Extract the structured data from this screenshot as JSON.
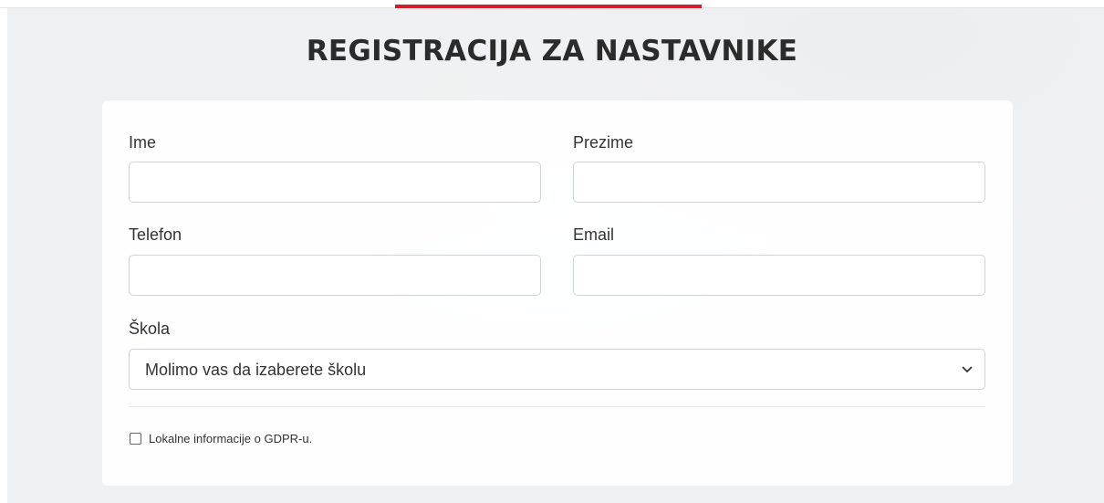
{
  "header": {
    "title": "REGISTRACIJA ZA NASTAVNIKE",
    "accent_color": "#d0202e"
  },
  "form": {
    "first_name": {
      "label": "Ime",
      "value": ""
    },
    "last_name": {
      "label": "Prezime",
      "value": ""
    },
    "phone": {
      "label": "Telefon",
      "value": ""
    },
    "email": {
      "label": "Email",
      "value": ""
    },
    "school": {
      "label": "Škola",
      "selected": "Molimo vas da izaberete školu",
      "icon": "chevron-down-icon"
    },
    "gdpr": {
      "label": "Lokalne informacije o GDPR-u.",
      "checked": false
    }
  }
}
